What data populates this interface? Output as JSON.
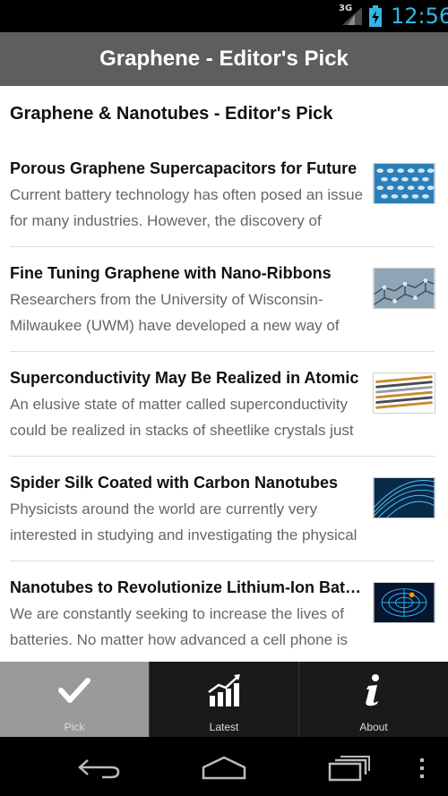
{
  "status_bar": {
    "network_type": "3G",
    "time": "12:56",
    "icons": [
      "signal-icon",
      "battery-charging-icon"
    ]
  },
  "action_bar": {
    "title": "Graphene - Editor's Pick"
  },
  "section": {
    "title": "Graphene & Nanotubes - Editor's Pick"
  },
  "articles": [
    {
      "title": "Porous Graphene Supercapacitors for Future",
      "summary": "Current battery technology has often posed an issue for many industries. However, the discovery of",
      "thumbnail_icon": "porous-graphene-thumbnail"
    },
    {
      "title": "Fine Tuning Graphene with Nano-Ribbons",
      "summary": "Researchers from the University of Wisconsin-Milwaukee (UWM) have developed a new way of",
      "thumbnail_icon": "nano-ribbons-thumbnail"
    },
    {
      "title": "Superconductivity May Be Realized in Atomic",
      "summary": "An elusive state of matter called superconductivity could be realized in stacks of sheetlike crystals just",
      "thumbnail_icon": "superconductivity-thumbnail"
    },
    {
      "title": "Spider Silk Coated with Carbon Nanotubes",
      "summary": "Physicists around the world are currently very interested in studying and investigating the physical",
      "thumbnail_icon": "spider-silk-thumbnail"
    },
    {
      "title": "Nanotubes to Revolutionize Lithium-Ion Batteries",
      "summary": "We are constantly seeking to increase the lives of batteries. No matter how advanced a cell phone is or",
      "thumbnail_icon": "nanotube-thumbnail"
    }
  ],
  "tabs": [
    {
      "label": "Pick",
      "icon": "checkmark-icon",
      "selected": true
    },
    {
      "label": "Latest",
      "icon": "chart-icon",
      "selected": false
    },
    {
      "label": "About",
      "icon": "info-icon",
      "selected": false
    }
  ],
  "nav_bar": {
    "icons": [
      "back-icon",
      "home-icon",
      "recent-apps-icon",
      "menu-icon"
    ]
  },
  "colors": {
    "accent": "#33b5e5",
    "action_bar": "#5e5e5e",
    "tab_selected": "#9a9a9a"
  }
}
